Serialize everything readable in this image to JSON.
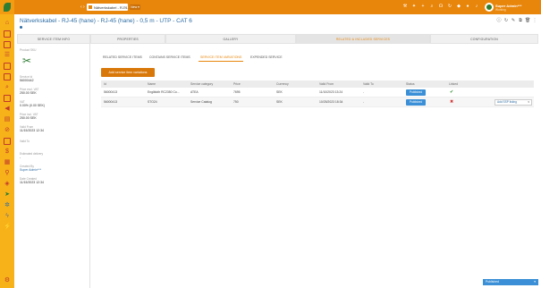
{
  "topbar": {
    "nav_arrows": "‹ ›",
    "tab_title": "Nätverkskabel - RJ-4...",
    "tab_close": "×",
    "new_label": "New ▾",
    "user_name": "Super Admin***",
    "user_status": "Working"
  },
  "header": {
    "title": "Nätverkskabel - RJ-45 (hane) - RJ-45 (hane) - 0,5 m - UTP - CAT 6"
  },
  "main_tabs": [
    "SERVICE ITEM INFO",
    "PROPERTIES",
    "GALLERY",
    "RELATED & INCLUDED SERVICES",
    "CONFIGURATION"
  ],
  "info": {
    "image_label": "Product SKU",
    "fields": [
      {
        "label": "Service Id",
        "value": "56000442"
      },
      {
        "label": "Price excl. VAT",
        "value": "250.00 SEK"
      },
      {
        "label": "VAT",
        "value": "0.00% (0.00 SEK)"
      },
      {
        "label": "Price incl. VAT",
        "value": "250.00 SEK"
      },
      {
        "label": "Valid From",
        "value": "11/15/2023 12:34"
      },
      {
        "label": "Valid To",
        "value": ""
      },
      {
        "label": "Estimated delivery",
        "value": "-"
      },
      {
        "label": "Created By",
        "value": "Super Admin***"
      },
      {
        "label": "Date Created",
        "value": "11/15/2023 12:34"
      }
    ]
  },
  "sub_tabs": [
    "RELATED SERVICE ITEMS",
    "CONTAINS SERVICE ITEMS",
    "SERVICE ITEM VARIATIONS",
    "EXPENDED SERVICE"
  ],
  "add_button": "Add service item variations",
  "table": {
    "headers": [
      "Id",
      "Name",
      "Service category",
      "Price",
      "Currency",
      "Valid From",
      "Valid To",
      "Status",
      "Linked",
      ""
    ],
    "rows": [
      {
        "id": "56000413",
        "name": "Englätcth RC2350 Co...",
        "category": "ATEA",
        "price": "7695",
        "currency": "SEK",
        "valid_from": "11/10/2023 13:24",
        "valid_to": "-",
        "status": "Published",
        "linked": "yes",
        "action": ""
      },
      {
        "id": "56000413",
        "name": "STO24",
        "category": "Service Catalog",
        "price": "750",
        "currency": "SEK",
        "valid_from": "10/25/2023 18:34",
        "valid_to": "-",
        "status": "Published",
        "linked": "no",
        "action": "Add SSP listing"
      }
    ]
  },
  "bottom_status": "Published",
  "colors": {
    "accent": "#e8860c",
    "sidebar": "#f7b21a",
    "link": "#2e6da4",
    "badge": "#3a8fd6"
  }
}
